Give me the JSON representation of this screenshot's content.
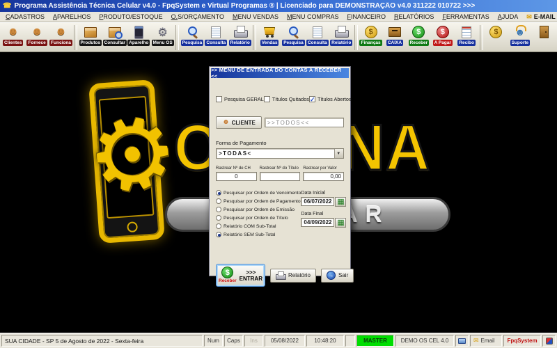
{
  "titlebar": {
    "title": "Programa Assistência Técnica Celular v4.0 - FpqSystem e Virtual Programas ® | Licenciado para  DEMONSTRAÇÃO v4.0 311222 010722 >>>"
  },
  "menubar": {
    "items": [
      "CADASTROS",
      "APARELHOS",
      "PRODUTO/ESTOQUE",
      "O.S/ORÇAMENTO",
      "MENU VENDAS",
      "MENU COMPRAS",
      "FINANCEIRO",
      "RELATÓRIOS",
      "FERRAMENTAS",
      "AJUDA"
    ],
    "email_label": "E-MAIL"
  },
  "toolbar": {
    "buttons": [
      {
        "label": "Clientes",
        "badge": "darkred",
        "icon": "person"
      },
      {
        "label": "Fornece",
        "badge": "darkred",
        "icon": "person"
      },
      {
        "label": "Funciona",
        "badge": "darkred",
        "icon": "person"
      },
      {
        "sep": true
      },
      {
        "label": "Produtos",
        "badge": "black",
        "icon": "box"
      },
      {
        "label": "Consultar",
        "badge": "black",
        "icon": "box-search"
      },
      {
        "label": "Aparelho",
        "badge": "black",
        "icon": "cellphone"
      },
      {
        "label": "Menu OS",
        "badge": "black",
        "icon": "tools"
      },
      {
        "sep": true
      },
      {
        "label": "Pesquisa",
        "badge": "blue",
        "icon": "search"
      },
      {
        "label": "Consulta",
        "badge": "blue",
        "icon": "doc"
      },
      {
        "label": "Relatório",
        "badge": "blue",
        "icon": "printer"
      },
      {
        "sep": true
      },
      {
        "label": "Vendas",
        "badge": "blue",
        "icon": "cart"
      },
      {
        "label": "Pesquisa",
        "badge": "blue",
        "icon": "search"
      },
      {
        "label": "Consulta",
        "badge": "blue",
        "icon": "doc"
      },
      {
        "label": "Relatório",
        "badge": "blue",
        "icon": "printer"
      },
      {
        "sep": true
      },
      {
        "label": "Finanças",
        "badge": "green",
        "icon": "dollar-yellow"
      },
      {
        "label": "CAIXA",
        "badge": "blue",
        "icon": "cashbox"
      },
      {
        "label": "Receber",
        "badge": "green",
        "icon": "dollar-green"
      },
      {
        "label": "A Pagar",
        "badge": "red",
        "icon": "dollar-red"
      },
      {
        "label": "Recibo",
        "badge": "blue",
        "icon": "receipt"
      },
      {
        "sep": true
      },
      {
        "label": "",
        "badge": "none",
        "icon": "coin"
      },
      {
        "label": "Suporte",
        "badge": "blue",
        "icon": "support"
      },
      {
        "label": "",
        "badge": "none",
        "icon": "door"
      }
    ]
  },
  "logo": {
    "word": "OFICINA",
    "banner": "CELULAR"
  },
  "dialog": {
    "title": ">> MENU DE ENTRADA DO CONTAS A RECEBER <<",
    "checkboxes": [
      {
        "label": "Pesquisa GERAL",
        "checked": false
      },
      {
        "label": "Títulos Quitados",
        "checked": false
      },
      {
        "label": "Títulos Abertos",
        "checked": true
      }
    ],
    "cliente_button_label": "CLIENTE",
    "cliente_value": ">>TODOS<<",
    "forma_pagamento_label": "Forma de Pagamento",
    "forma_pagamento_value": ">TODAS<",
    "rastrear": {
      "ch_label": "Rastrear Nº de CH",
      "ch_value": "0",
      "titulo_label": "Rastrear Nº do Título",
      "titulo_value": "",
      "valor_label": "Rastrear por Valor",
      "valor_value": "0,00"
    },
    "radios": [
      {
        "label": "Pesquisar por Ordem de Vencimento",
        "selected": true
      },
      {
        "label": "Pesquisar por Ordem de Pagamento",
        "selected": false
      },
      {
        "label": "Pesquisar por Ordem de Emissão",
        "selected": false
      },
      {
        "label": "Pesquisar por Ordem de Título",
        "selected": false
      },
      {
        "label": "Relatório COM Sub-Total",
        "selected": false
      },
      {
        "label": "Relatório SEM Sub-Total",
        "selected": true
      }
    ],
    "data_inicial_label": "Data Inicial",
    "data_inicial_value": "06/07/2022",
    "data_final_label": "Data Final",
    "data_final_value": "04/09/2022",
    "entrar_label": ">>> ENTRAR",
    "entrar_sublabel": "Receber",
    "relatorio_label": "Relatório",
    "sair_label": "Sair"
  },
  "statusbar": {
    "location": "SUA CIDADE - SP  5 de Agosto de 2022 - Sexta-feira",
    "num": "Num",
    "caps": "Caps",
    "ins": "Ins",
    "date": "05/08/2022",
    "time": "10:48:20",
    "user": "MASTER",
    "product": "DEMO OS CEL 4.0",
    "email": "Email",
    "brand": "FpqSystem"
  },
  "colors": {
    "title_gradient_start": "#16359c",
    "title_gradient_end": "#5d97e6",
    "logo_gold": "#f4c400",
    "master_green": "#00dd00",
    "brand_red": "#c01010"
  }
}
